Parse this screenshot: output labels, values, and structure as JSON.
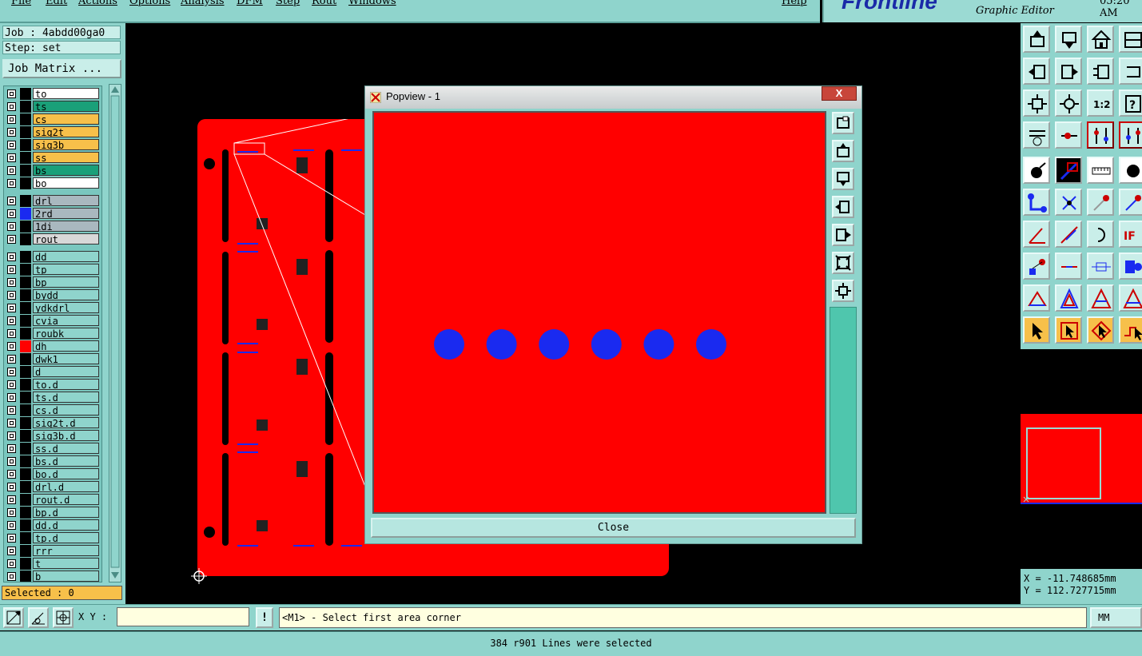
{
  "menubar": {
    "items": [
      "File",
      "Edit",
      "Actions",
      "Options",
      "Analysis",
      "DFM",
      "Step",
      "Rout",
      "Windows"
    ],
    "help": "Help"
  },
  "brand": {
    "logo": "Frontline",
    "subtitle": "Graphic Editor",
    "time": "05:20 AM"
  },
  "left": {
    "job": "Job : 4abdd00ga0",
    "step": "Step: set",
    "job_matrix": "Job Matrix ...",
    "selected": "Selected : 0",
    "layers": [
      {
        "name": "to",
        "bg": "#ffffff",
        "swatch": "#000000"
      },
      {
        "name": "ts",
        "bg": "#1aa079",
        "swatch": "#000000"
      },
      {
        "name": "cs",
        "bg": "#f7c04a",
        "swatch": "#000000"
      },
      {
        "name": "sig2t",
        "bg": "#f7c04a",
        "swatch": "#000000"
      },
      {
        "name": "sig3b",
        "bg": "#f7c04a",
        "swatch": "#000000"
      },
      {
        "name": "ss",
        "bg": "#f7c04a",
        "swatch": "#000000"
      },
      {
        "name": "bs",
        "bg": "#1aa079",
        "swatch": "#000000"
      },
      {
        "name": "bo",
        "bg": "#ffffff",
        "swatch": "#000000"
      },
      {
        "name": "drl",
        "bg": "#a9b8bf",
        "swatch": "#000000"
      },
      {
        "name": "2rd",
        "bg": "#a9b8bf",
        "swatch": "#1a2af0"
      },
      {
        "name": "1di",
        "bg": "#a9b8bf",
        "swatch": "#000000"
      },
      {
        "name": "rout",
        "bg": "#d8d8d8",
        "swatch": "#000000"
      },
      {
        "name": "dd",
        "bg": "#8fd4cc",
        "swatch": "#000000"
      },
      {
        "name": "tp",
        "bg": "#8fd4cc",
        "swatch": "#000000"
      },
      {
        "name": "bp",
        "bg": "#8fd4cc",
        "swatch": "#000000"
      },
      {
        "name": "bydd",
        "bg": "#8fd4cc",
        "swatch": "#000000"
      },
      {
        "name": "ydkdrl",
        "bg": "#8fd4cc",
        "swatch": "#000000"
      },
      {
        "name": "cvia",
        "bg": "#8fd4cc",
        "swatch": "#000000"
      },
      {
        "name": "roubk",
        "bg": "#8fd4cc",
        "swatch": "#000000"
      },
      {
        "name": "dh",
        "bg": "#8fd4cc",
        "swatch": "#ff0000"
      },
      {
        "name": "dwk1",
        "bg": "#8fd4cc",
        "swatch": "#000000"
      },
      {
        "name": "d",
        "bg": "#8fd4cc",
        "swatch": "#000000"
      },
      {
        "name": "to.d",
        "bg": "#8fd4cc",
        "swatch": "#000000"
      },
      {
        "name": "ts.d",
        "bg": "#8fd4cc",
        "swatch": "#000000"
      },
      {
        "name": "cs.d",
        "bg": "#8fd4cc",
        "swatch": "#000000"
      },
      {
        "name": "sig2t.d",
        "bg": "#8fd4cc",
        "swatch": "#000000"
      },
      {
        "name": "sig3b.d",
        "bg": "#8fd4cc",
        "swatch": "#000000"
      },
      {
        "name": "ss.d",
        "bg": "#8fd4cc",
        "swatch": "#000000"
      },
      {
        "name": "bs.d",
        "bg": "#8fd4cc",
        "swatch": "#000000"
      },
      {
        "name": "bo.d",
        "bg": "#8fd4cc",
        "swatch": "#000000"
      },
      {
        "name": "drl.d",
        "bg": "#8fd4cc",
        "swatch": "#000000"
      },
      {
        "name": "rout.d",
        "bg": "#8fd4cc",
        "swatch": "#000000"
      },
      {
        "name": "bp.d",
        "bg": "#8fd4cc",
        "swatch": "#000000"
      },
      {
        "name": "dd.d",
        "bg": "#8fd4cc",
        "swatch": "#000000"
      },
      {
        "name": "tp.d",
        "bg": "#8fd4cc",
        "swatch": "#000000"
      },
      {
        "name": "rrr",
        "bg": "#8fd4cc",
        "swatch": "#000000"
      },
      {
        "name": "t",
        "bg": "#8fd4cc",
        "swatch": "#000000"
      },
      {
        "name": "b",
        "bg": "#8fd4cc",
        "swatch": "#000000"
      }
    ]
  },
  "popview": {
    "title": "Popview - 1",
    "close_label": "Close",
    "close_x": "X",
    "pad_color": "#1a2af0",
    "pad_count": 6
  },
  "right": {
    "coord_x": "X = -11.748685mm",
    "coord_y": "Y = 112.727715mm"
  },
  "bottom": {
    "xy_label": "X Y :",
    "xy_value": "",
    "excl": "!",
    "prompt": "<M1> - Select first area corner",
    "units": "MM",
    "status": "384 r901 Lines were selected"
  },
  "colors": {
    "panel": "#8fd4cc",
    "board": "#ff0000",
    "selected_bg": "#f7c04a"
  }
}
